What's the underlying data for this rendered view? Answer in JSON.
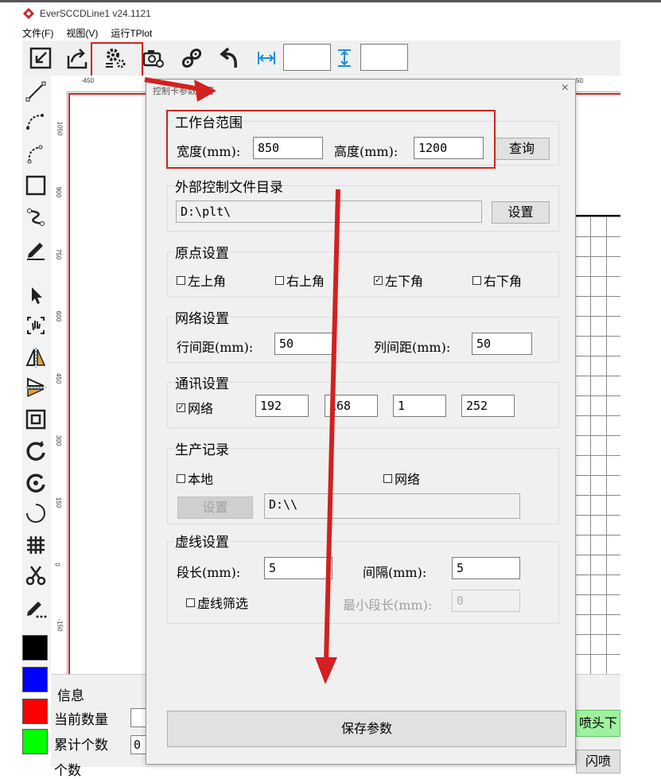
{
  "app": {
    "title": "EverSCCDLine1 v24.1121"
  },
  "menu": [
    "文件(F)",
    "视图(V)",
    "运行TPlot"
  ],
  "toolbar": {
    "icons": [
      "import-icon",
      "export-icon",
      "settings-gears-icon",
      "camera-settings-icon",
      "chain-link-icon",
      "undo-icon",
      "horizontal-span-icon",
      "vertical-span-icon"
    ],
    "width_value": "",
    "height_value": ""
  },
  "ruler": {
    "top": [
      "-450",
      "50"
    ],
    "left": [
      "1050",
      "900",
      "750",
      "600",
      "450",
      "300",
      "150",
      "0",
      "-150"
    ]
  },
  "colors": {
    "swatches": [
      "#000000",
      "#0000ff",
      "#ff0000",
      "#00ff00"
    ],
    "annotation": "#d32020"
  },
  "info": {
    "title": "信息",
    "current_count_label": "当前数量",
    "total_count_label": "累计个数",
    "total_count_value": "0",
    "partial_label": "个数",
    "nozzle_button": "喷头下",
    "flash_button": "闪喷"
  },
  "dialog": {
    "title": "控制卡参数设置",
    "close": "×",
    "workbench": {
      "title": "工作台范围",
      "width_label": "宽度(mm):",
      "width_value": "850",
      "height_label": "高度(mm):",
      "height_value": "1200",
      "query_button": "查询"
    },
    "external_dir": {
      "title": "外部控制文件目录",
      "path": "D:\\plt\\",
      "set_button": "设置"
    },
    "origin": {
      "title": "原点设置",
      "options": [
        {
          "label": "左上角",
          "checked": false
        },
        {
          "label": "右上角",
          "checked": false
        },
        {
          "label": "左下角",
          "checked": true
        },
        {
          "label": "右下角",
          "checked": false
        }
      ]
    },
    "grid": {
      "title": "网络设置",
      "row_label": "行间距(mm):",
      "row_value": "50",
      "col_label": "列间距(mm):",
      "col_value": "50"
    },
    "comm": {
      "title": "通讯设置",
      "network_label": "网络",
      "network_checked": true,
      "ip": [
        "192",
        "168",
        "1",
        "252"
      ]
    },
    "production": {
      "title": "生产记录",
      "local_label": "本地",
      "local_checked": false,
      "network_label": "网络",
      "network_checked": false,
      "set_button": "设置",
      "path": "D:\\\\"
    },
    "dash": {
      "title": "虚线设置",
      "seg_label": "段长(mm):",
      "seg_value": "5",
      "gap_label": "间隔(mm):",
      "gap_value": "5",
      "filter_label": "虚线筛选",
      "filter_checked": false,
      "min_seg_label": "最小段长(mm):",
      "min_seg_value": "0"
    },
    "save_button": "保存参数"
  }
}
